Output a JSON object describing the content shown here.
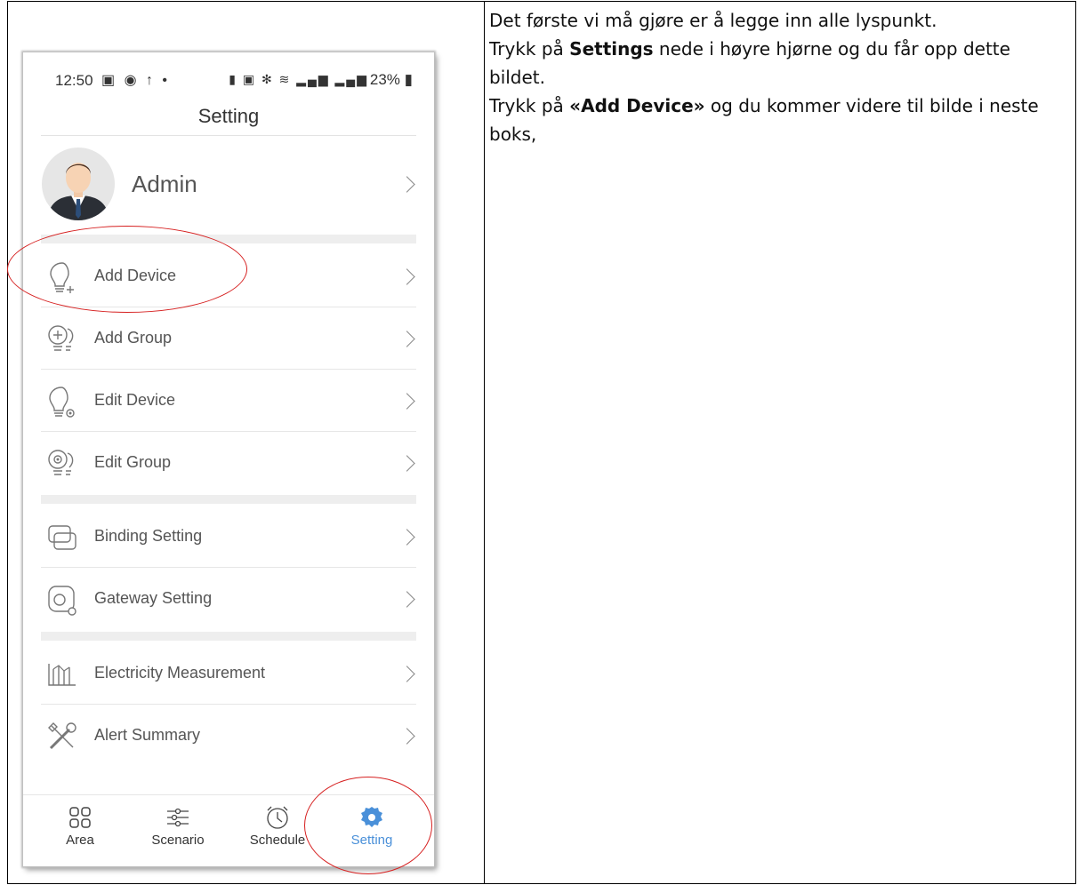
{
  "instructions": {
    "line1": "Det første vi må gjøre er å legge inn alle lyspunkt.",
    "line2_prefix": "Trykk på ",
    "line2_bold": "Settings",
    "line2_suffix": " nede i høyre hjørne og du får opp dette bildet.",
    "line3_prefix": " Trykk på ",
    "line3_bold": "«Add Device»",
    "line3_suffix": " og du kommer videre til bilde i neste boks,"
  },
  "status_bar": {
    "time": "12:50",
    "battery": "23%"
  },
  "screen": {
    "title": "Setting",
    "profile_name": "Admin"
  },
  "menu": [
    {
      "label": "Add Device",
      "icon": "bulb-plus-icon"
    },
    {
      "label": "Add Group",
      "icon": "bulbs-plus-icon"
    },
    {
      "label": "Edit Device",
      "icon": "bulb-gear-icon"
    },
    {
      "label": "Edit Group",
      "icon": "bulbs-gear-icon"
    },
    {
      "label": "Binding Setting",
      "icon": "binding-icon"
    },
    {
      "label": "Gateway Setting",
      "icon": "gateway-icon"
    },
    {
      "label": "Electricity Measurement",
      "icon": "chart-icon"
    },
    {
      "label": "Alert Summary",
      "icon": "tools-icon"
    }
  ],
  "nav": [
    {
      "label": "Area",
      "icon": "grid-icon"
    },
    {
      "label": "Scenario",
      "icon": "sliders-icon"
    },
    {
      "label": "Schedule",
      "icon": "clock-icon"
    },
    {
      "label": "Setting",
      "icon": "gear-icon"
    }
  ],
  "colors": {
    "highlight": "#d62020",
    "active_nav": "#4a90d9"
  }
}
